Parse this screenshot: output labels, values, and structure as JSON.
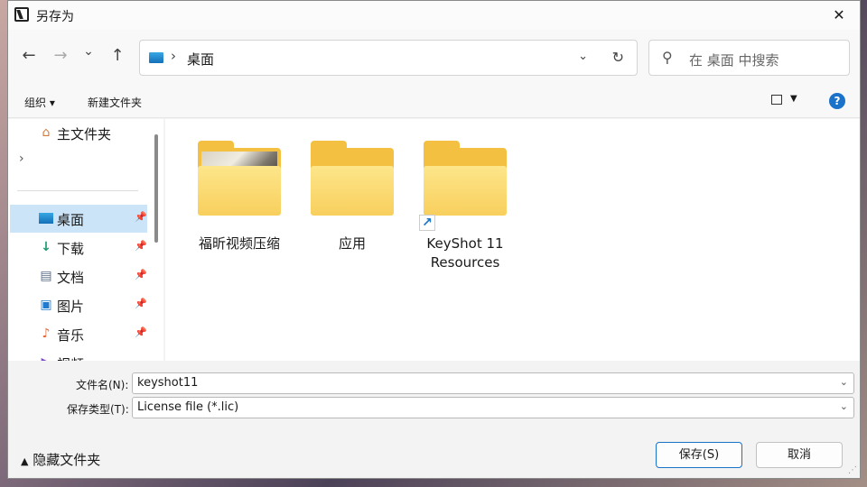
{
  "window": {
    "title": "另存为",
    "close": "✕"
  },
  "nav": {
    "back": "←",
    "forward": "→",
    "recent": "⌄",
    "up": "↑"
  },
  "address": {
    "separator": "›",
    "location": "桌面",
    "dropdown": "⌄",
    "refresh": "↻"
  },
  "search": {
    "placeholder": "在 桌面 中搜索"
  },
  "commands": {
    "organize": "组织 ▾",
    "new_folder": "新建文件夹",
    "help": "?"
  },
  "sidebar": {
    "home": "主文件夹",
    "items": [
      {
        "label": "桌面",
        "icon": "desktop-icon"
      },
      {
        "label": "下载",
        "icon": "download-icon"
      },
      {
        "label": "文档",
        "icon": "document-icon"
      },
      {
        "label": "图片",
        "icon": "pictures-icon"
      },
      {
        "label": "音乐",
        "icon": "music-icon"
      },
      {
        "label": "视频",
        "icon": "video-icon"
      }
    ]
  },
  "folders": [
    {
      "name": "福昕视频压缩"
    },
    {
      "name": "应用"
    },
    {
      "name": "KeyShot 11 Resources"
    }
  ],
  "form": {
    "filename_label": "文件名(N):",
    "filename_value": "keyshot11",
    "filetype_label": "保存类型(T):",
    "filetype_value": "License file (*.lic)"
  },
  "footer": {
    "hide_folders": "隐藏文件夹",
    "save": "保存(S)",
    "cancel": "取消"
  },
  "colors": {
    "accent": "#1b72c9",
    "selected": "#cce4f7",
    "folder": "#f4c042"
  }
}
